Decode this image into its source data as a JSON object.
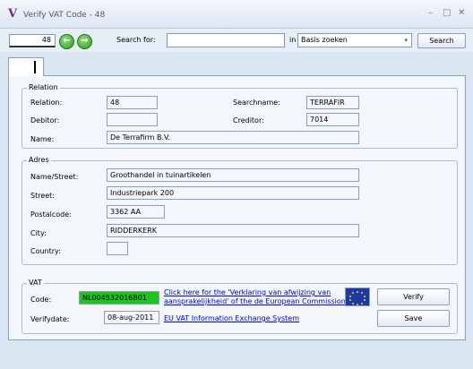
{
  "window": {
    "title": "Verify VAT Code - 48",
    "logo": "V",
    "minimize": "–",
    "maximize": "□",
    "close": "✕"
  },
  "toolbar": {
    "record_number": "48",
    "prev_icon": "arrow-left-icon",
    "next_icon": "arrow-right-icon",
    "search_label": "Search for:",
    "search_value": "",
    "in_label": "in",
    "search_scope": "Basis zoeken",
    "search_button": "Search"
  },
  "relation": {
    "title": "Relation",
    "relation_label": "Relation:",
    "relation_value": "48",
    "searchname_label": "Searchname:",
    "searchname_value": "TERRAFIR",
    "debitor_label": "Debitor:",
    "debitor_value": "",
    "creditor_label": "Creditor:",
    "creditor_value": "7014",
    "name_label": "Name:",
    "name_value": "De Terrafirm B.V."
  },
  "adres": {
    "title": "Adres",
    "namestreet_label": "Name/Street:",
    "namestreet_value": "Groothandel in tuinartikelen",
    "street_label": "Street:",
    "street_value": "Industriepark 200",
    "postalcode_label": "Postalcode:",
    "postalcode_value": "3362 AA",
    "city_label": "City:",
    "city_value": "RIDDERKERK",
    "country_label": "Country:",
    "country_value": ""
  },
  "vat": {
    "title": "VAT",
    "code_label": "Code:",
    "code_value": "NL004532016B01",
    "link_line1": "Click here for the 'Verklaring van afwijzing van",
    "link_line2": "aansprakelijkheid' of the de European Commission",
    "flag_icon": "eu-flag-icon",
    "verify_button": "Verify",
    "verifydate_label": "Verifydate:",
    "verifydate_value": "08-aug-2011",
    "vies_link": "EU VAT Information Exchange System",
    "save_button": "Save"
  },
  "colors": {
    "vat_valid": "#1cc41c",
    "link": "#0000cc",
    "logo": "#6a2c86",
    "nav_button": "#2e9b1f"
  }
}
